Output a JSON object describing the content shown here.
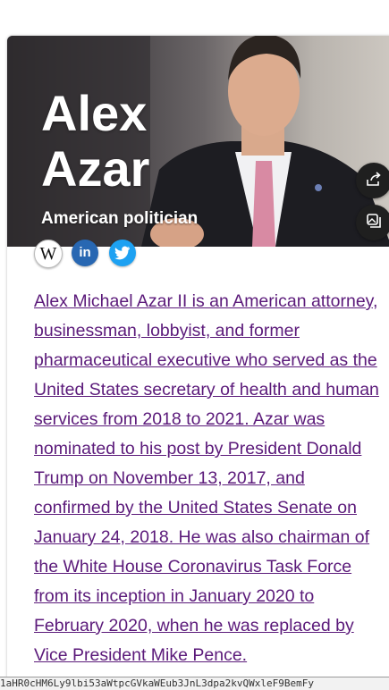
{
  "profile": {
    "name_line1": "Alex",
    "name_line2": "Azar",
    "subtitle": "American politician"
  },
  "actions": {
    "share_icon": "share-icon",
    "image_icon": "image-gallery-icon"
  },
  "social": [
    {
      "name": "wikipedia-icon",
      "glyph": "W",
      "color": "#ffffff"
    },
    {
      "name": "linkedin-icon",
      "glyph": "in",
      "color": "#2867b2"
    },
    {
      "name": "twitter-icon",
      "glyph": "",
      "color": "#1da1f2"
    }
  ],
  "description": "Alex Michael Azar II is an American attorney, businessman, lobbyist, and former pharmaceutical executive who served as the United States secretary of health and human services from 2018 to 2021. Azar was nominated to his post by President Donald Trump on November 13, 2017, and confirmed by the United States Senate on January 24, 2018. He was also chairman of the White House Coronavirus Task Force from its inception in January 2020 to February 2020, when he was replaced by Vice President Mike Pence.",
  "status_bar": {
    "url": "1aHR0cHM6Ly9lbi53aWtpcGVkaWEub3JnL3dpa2kvQWxleF9BemFy"
  },
  "colors": {
    "link": "#5b1a7a",
    "button_bg": "#1f1f1f"
  }
}
